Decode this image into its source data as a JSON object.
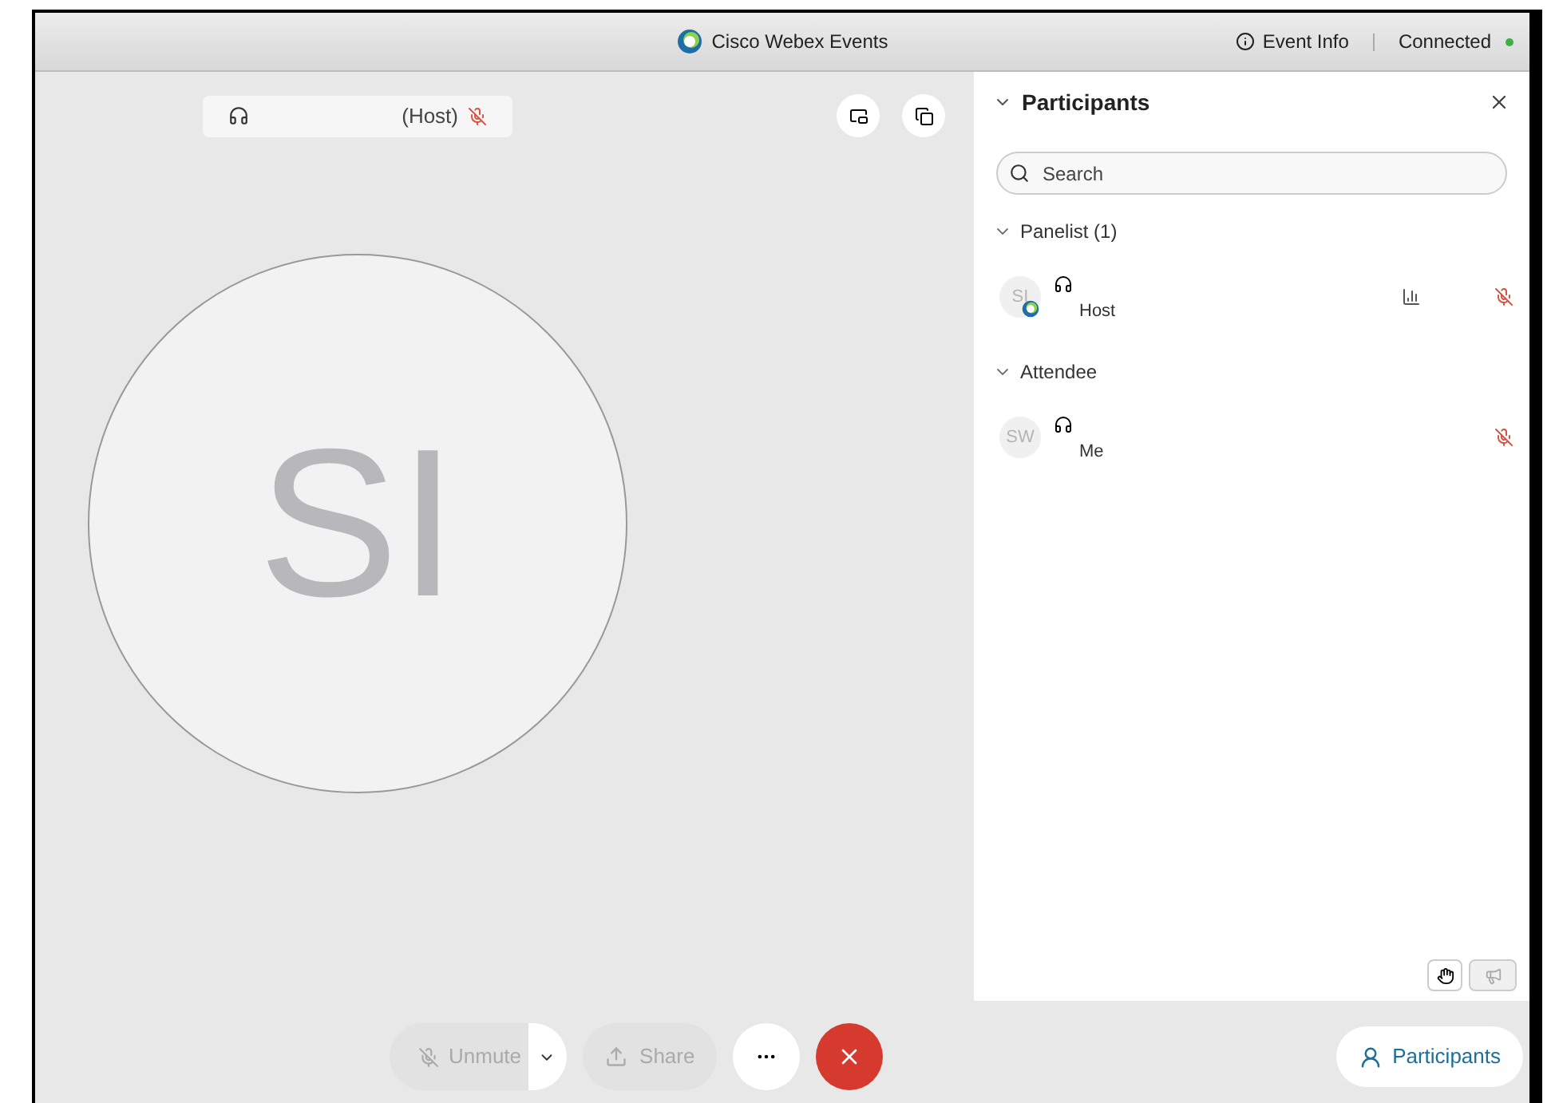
{
  "window": {
    "title": "Cisco Webex Events",
    "event_info": "Event Info",
    "status": "Connected",
    "connected": true
  },
  "stage": {
    "speaker_label": "(Host)",
    "speaker_muted": true,
    "avatar_initials": "SI"
  },
  "panel": {
    "title": "Participants",
    "search": {
      "placeholder": "Search"
    },
    "groups": [
      {
        "label": "Panelist (1)",
        "expanded": true,
        "members": [
          {
            "initials": "SI",
            "role": "Host",
            "presenter": true,
            "audio_bars": true,
            "muted": true
          }
        ]
      },
      {
        "label": "Attendee",
        "expanded": true,
        "members": [
          {
            "initials": "SW",
            "role": "Me",
            "presenter": false,
            "audio_bars": false,
            "muted": true
          }
        ]
      }
    ]
  },
  "controls": {
    "unmute": {
      "label": "Unmute",
      "disabled": true
    },
    "share": {
      "label": "Share",
      "disabled": true
    }
  },
  "participants_button": "Participants"
}
